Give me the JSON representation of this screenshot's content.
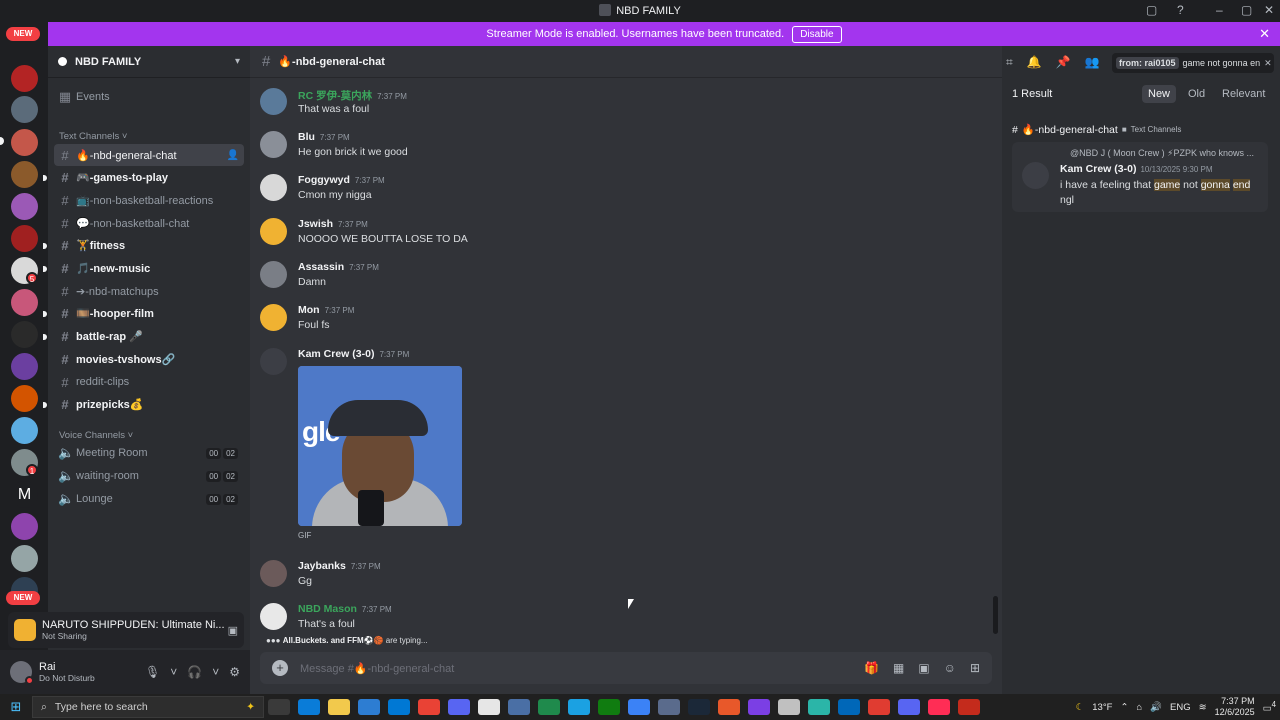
{
  "window": {
    "title": "NBD FAMILY"
  },
  "streamer": {
    "message": "Streamer Mode is enabled. Usernames have been truncated.",
    "disable_label": "Disable"
  },
  "guilds": {
    "new_label": "NEW",
    "ping_1": "5",
    "ping_2": "1"
  },
  "sidebar": {
    "server_name": "NBD FAMILY",
    "events_label": "Events",
    "text_category": "Text Channels",
    "voice_category": "Voice Channels",
    "channels": [
      {
        "label": "🔥-nbd-general-chat"
      },
      {
        "label": "🎮-games-to-play"
      },
      {
        "label": "📺-non-basketball-reactions"
      },
      {
        "label": "💬-non-basketball-chat"
      },
      {
        "label": "🏋️fitness"
      },
      {
        "label": "🎵-new-music"
      },
      {
        "label": "➔-nbd-matchups"
      },
      {
        "label": "🎞️-hooper-film"
      },
      {
        "label": "battle-rap 🎤"
      },
      {
        "label": "movies-tvshows🔗"
      },
      {
        "label": "reddit-clips"
      },
      {
        "label": "prizepicks💰"
      }
    ],
    "voice": [
      {
        "label": "Meeting Room",
        "a": "00",
        "b": "02"
      },
      {
        "label": "waiting-room",
        "a": "00",
        "b": "02"
      },
      {
        "label": "Lounge",
        "a": "00",
        "b": "02"
      }
    ]
  },
  "activity": {
    "game": "NARUTO SHIPPUDEN: Ultimate Ni...",
    "status": "Not Sharing"
  },
  "user": {
    "name": "Rai",
    "status": "Do Not Disturb"
  },
  "chat": {
    "channel": "🔥-nbd-general-chat",
    "messages": [
      {
        "author": "RC 罗伊-莫内林",
        "time": "7:37 PM",
        "text": "That was a foul"
      },
      {
        "author": "Blu",
        "time": "7:37 PM",
        "text": "He gon brick it we good"
      },
      {
        "author": "Foggywyd",
        "time": "7:37 PM",
        "text": "Cmon my nigga"
      },
      {
        "author": "Jswish",
        "time": "7:37 PM",
        "text": "NOOOO WE BOUTTA LOSE TO DA"
      },
      {
        "author": "Assassin",
        "time": "7:37 PM",
        "text": "Damn"
      },
      {
        "author": "Mon",
        "time": "7:37 PM",
        "text": "Foul fs"
      },
      {
        "author": "Kam Crew (3-0)",
        "time": "7:37 PM",
        "text": ""
      },
      {
        "author": "Jaybanks",
        "time": "7:37 PM",
        "text": "Gg"
      },
      {
        "author": "NBD Mason",
        "time": "7:37 PM",
        "text": "That's a foul"
      }
    ],
    "gif_label": "GIF",
    "gif_text": "gle",
    "typing_users": "All.Buckets. and FFM⚽🏀",
    "typing_suffix": " are typing...",
    "composer_placeholder": "Message #🔥-nbd-general-chat"
  },
  "search": {
    "filter": "from: rai0105",
    "query": "game not gonna en",
    "results": "1 Result",
    "sort": [
      "New",
      "Old",
      "Relevant"
    ],
    "channel": "🔥-nbd-general-chat",
    "channel_sub": "Text Channels",
    "reply_preview": "@NBD J ( Moon Crew ) ⚡PZPK who knows ...",
    "author": "Kam Crew (3-0)",
    "time": "10/13/2025 9:30 PM",
    "body_1": "i have a feeling that ",
    "hl_1": "game",
    "body_2": " not ",
    "hl_2": "gonna",
    "body_3": " ",
    "hl_3": "end",
    "body_4": " ngl"
  },
  "taskbar": {
    "search_placeholder": "Type here to search",
    "weather": "13°F",
    "lang": "ENG",
    "time": "7:37 PM",
    "date": "12/6/2025",
    "notifications": "4"
  }
}
